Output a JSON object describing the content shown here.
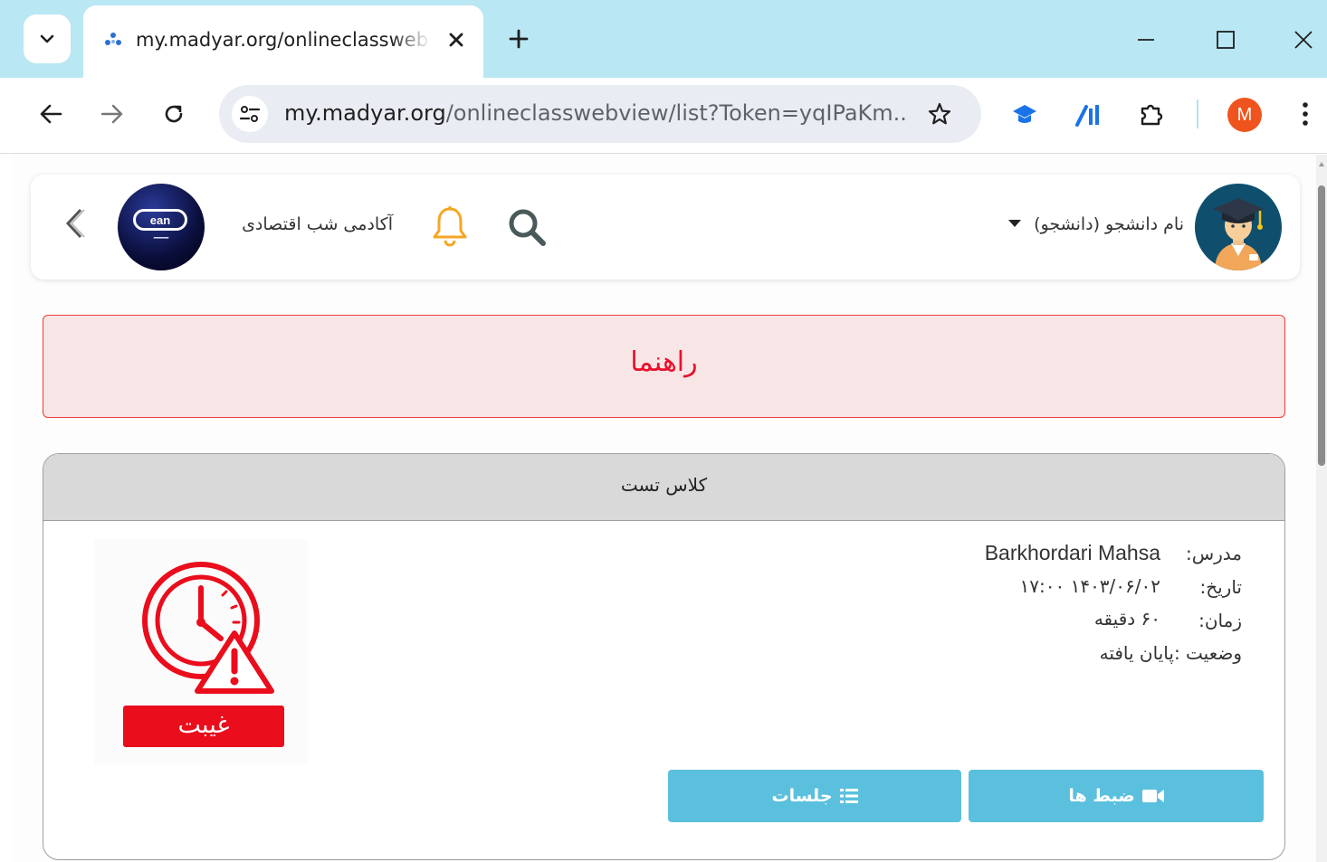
{
  "browser": {
    "tab": {
      "title": "my.madyar.org/onlineclasswebview"
    },
    "url": {
      "host": "my.madyar.org",
      "path": "/onlineclasswebview/list?Token=yqIPaKm..."
    },
    "profile_initial": "M"
  },
  "header": {
    "academy_name": "آکادمی شب اقتصادی",
    "academy_logo_text": "ean",
    "user_label": "نام دانشجو (دانشجو)"
  },
  "guide": {
    "text": "راهنما"
  },
  "class_card": {
    "title": "کلاس تست",
    "teacher_label": "مدرس:",
    "teacher_value": "Barkhordari Mahsa",
    "date_label": "تاریخ:",
    "date_value": "۱۷:۰۰ ۱۴۰۳/۰۶/۰۲",
    "duration_label": "زمان:",
    "duration_value": "۶۰ دقیقه",
    "status_line": "وضعیت :پایان یافته",
    "absence_label": "غیبت",
    "sessions_button": "جلسات",
    "recordings_button": "ضبط ها"
  },
  "colors": {
    "tabstrip": "#b9e7f3",
    "accent_button": "#5bc0de",
    "guide_text": "#e8112b",
    "absence": "#ea0d1c",
    "bell": "#f5a623",
    "search": "#4a5a5a"
  }
}
